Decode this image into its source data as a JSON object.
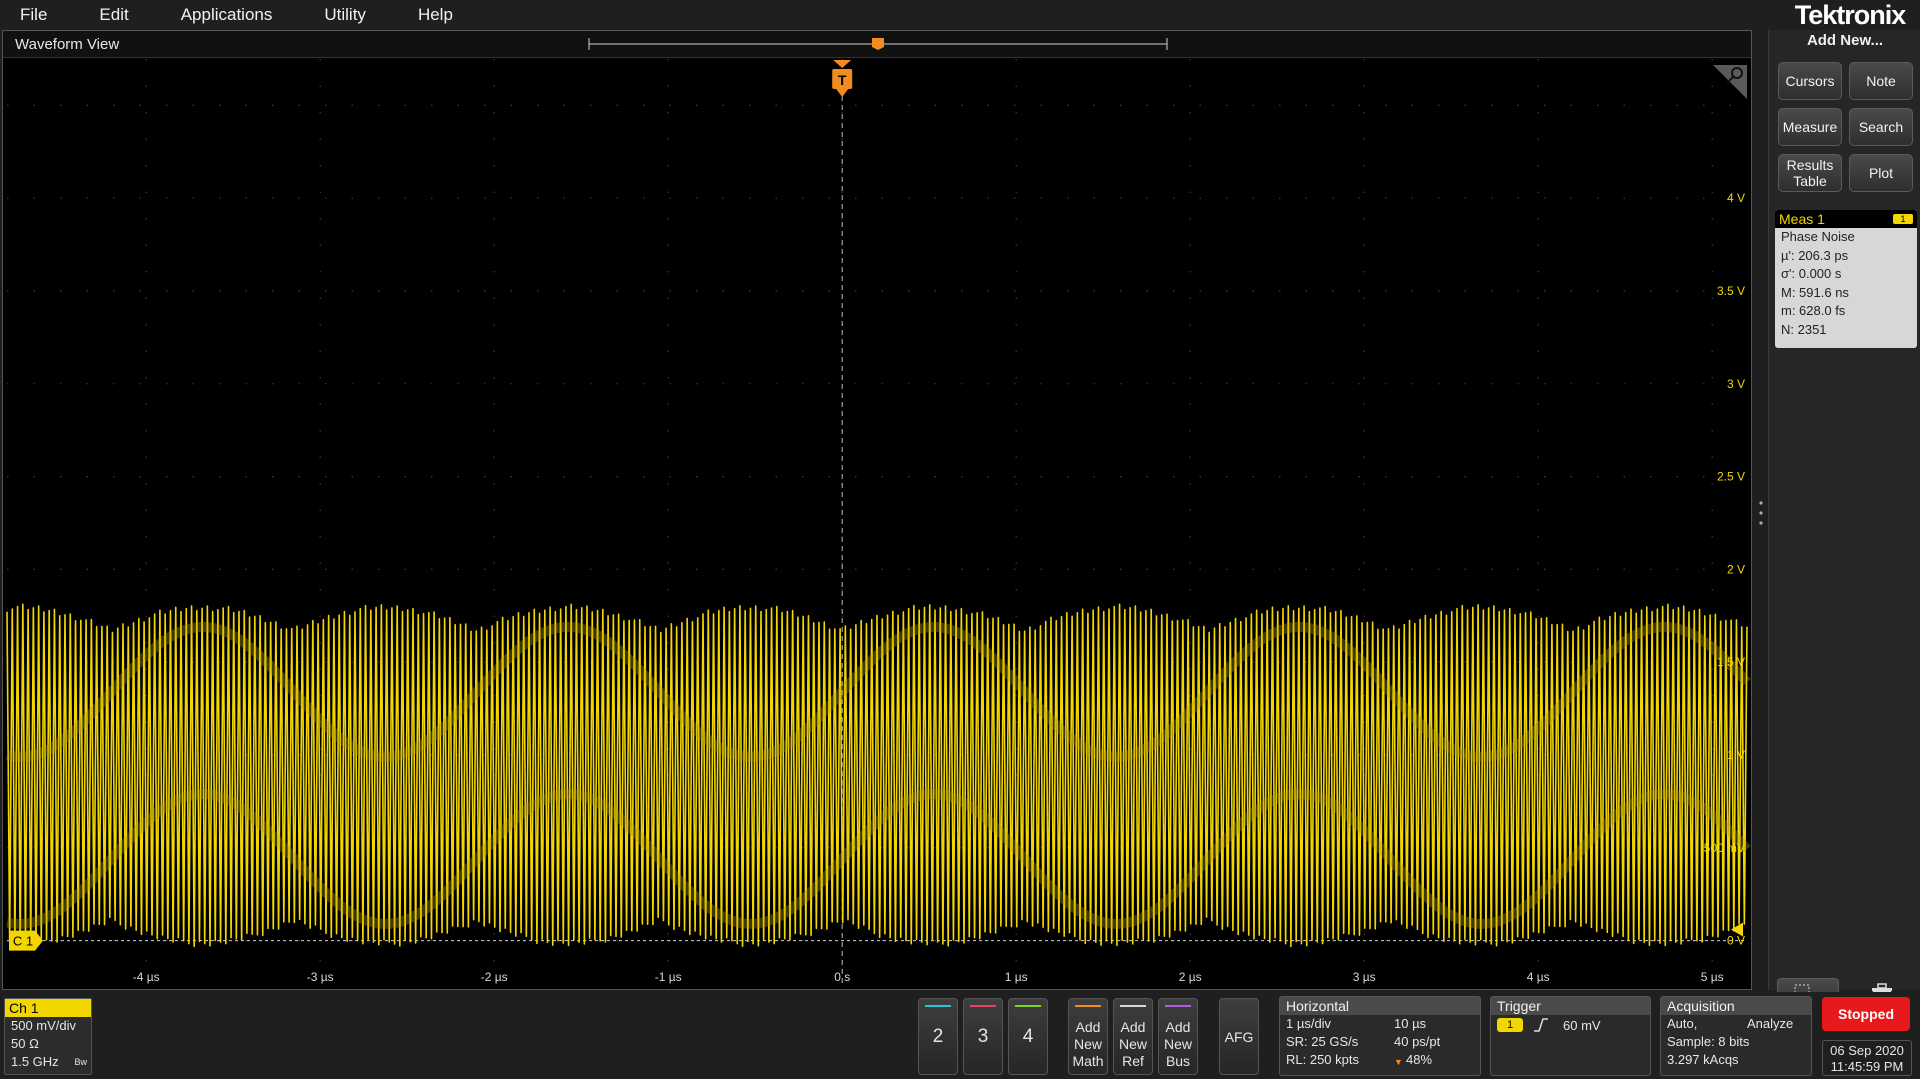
{
  "menu": [
    "File",
    "Edit",
    "Applications",
    "Utility",
    "Help"
  ],
  "brand": "Tektronix",
  "waveform_view": {
    "title": "Waveform View",
    "trigger_marker": "T",
    "channel_marker": "C 1",
    "y_ticks": [
      "4 V",
      "3.5 V",
      "3 V",
      "2.5 V",
      "2 V",
      "1.5 V",
      "1 V",
      "500 mV",
      "0 V"
    ],
    "x_ticks": [
      "-4 µs",
      "-3 µs",
      "-2 µs",
      "-1 µs",
      "0 s",
      "1 µs",
      "2 µs",
      "3 µs",
      "4 µs",
      "5 µs"
    ],
    "trace_color": "#f2d600",
    "trigger_color": "#f28c1e"
  },
  "chart_data": {
    "type": "line",
    "title": "",
    "xlabel": "",
    "ylabel": "",
    "x_unit": "µs",
    "y_unit": "V",
    "xlim": [
      -4.8,
      5.2
    ],
    "ylim": [
      -0.25,
      4.75
    ],
    "grid": true,
    "series": [
      {
        "signal": "amplitude-modulated sine",
        "y_min": 0.0,
        "y_max": 1.77,
        "y_center": 0.89,
        "cycles_in_view": 330,
        "envelope_period_us": 2.1
      }
    ]
  },
  "side_panel": {
    "add_new": "Add New...",
    "buttons": [
      "Cursors",
      "Note",
      "Measure",
      "Search",
      "Results Table",
      "Plot"
    ],
    "meas": {
      "title": "Meas 1",
      "badge": "1",
      "lines": [
        "Phase Noise",
        "µ': 206.3 ps",
        "σ': 0.000 s",
        "M: 591.6 ns",
        "m: 628.0 fs",
        "N: 2351"
      ]
    }
  },
  "bottom": {
    "ch1": {
      "title": "Ch 1",
      "scale": "500 mV/div",
      "impedance": "50 Ω",
      "bandwidth": "1.5 GHz",
      "bw_mark": "Bw"
    },
    "channels": [
      {
        "label": "2",
        "color": "#26c6da"
      },
      {
        "label": "3",
        "color": "#e8455a"
      },
      {
        "label": "4",
        "color": "#7ed321"
      }
    ],
    "add_buttons": [
      {
        "label": "Add New Math",
        "color": "#f28c1e"
      },
      {
        "label": "Add New Ref",
        "color": "#d8d8d8"
      },
      {
        "label": "Add New Bus",
        "color": "#b05de0"
      }
    ],
    "afg": "AFG",
    "horizontal": {
      "title": "Horizontal",
      "scale": "1 µs/div",
      "length": "10 µs",
      "sr": "SR: 25 GS/s",
      "res": "40 ps/pt",
      "rl": "RL: 250 kpts",
      "pos": "48%"
    },
    "trigger": {
      "title": "Trigger",
      "source": "1",
      "level": "60 mV"
    },
    "acquisition": {
      "title": "Acquisition",
      "mode": "Auto,",
      "analyze": "Analyze",
      "sample": "Sample: 8 bits",
      "acqs": "3.297 kAcqs"
    },
    "stopped": "Stopped",
    "date": "06 Sep 2020",
    "time": "11:45:59 PM"
  }
}
